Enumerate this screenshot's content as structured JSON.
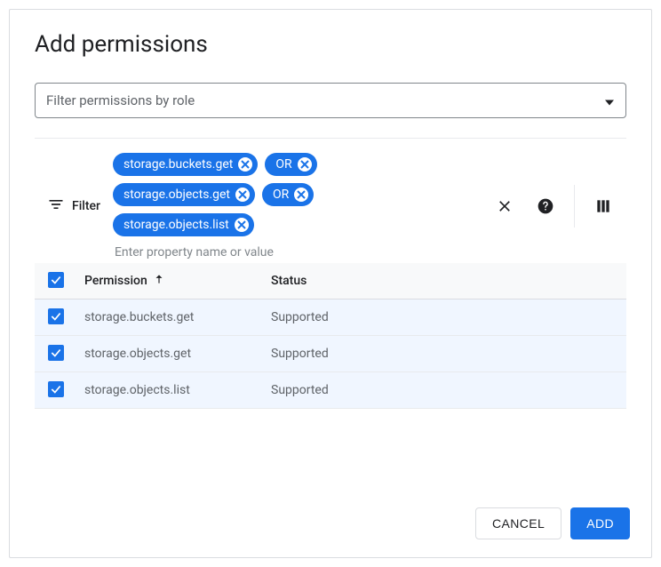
{
  "dialog": {
    "title": "Add permissions",
    "select_placeholder": "Filter permissions by role",
    "filter_label": "Filter",
    "filter_input_hint": "Enter property name or value",
    "or_label": "OR",
    "chips": [
      "storage.buckets.get",
      "storage.objects.get",
      "storage.objects.list"
    ],
    "table": {
      "col_permission": "Permission",
      "col_status": "Status",
      "rows": [
        {
          "permission": "storage.buckets.get",
          "status": "Supported"
        },
        {
          "permission": "storage.objects.get",
          "status": "Supported"
        },
        {
          "permission": "storage.objects.list",
          "status": "Supported"
        }
      ]
    },
    "actions": {
      "cancel": "CANCEL",
      "add": "ADD"
    }
  }
}
